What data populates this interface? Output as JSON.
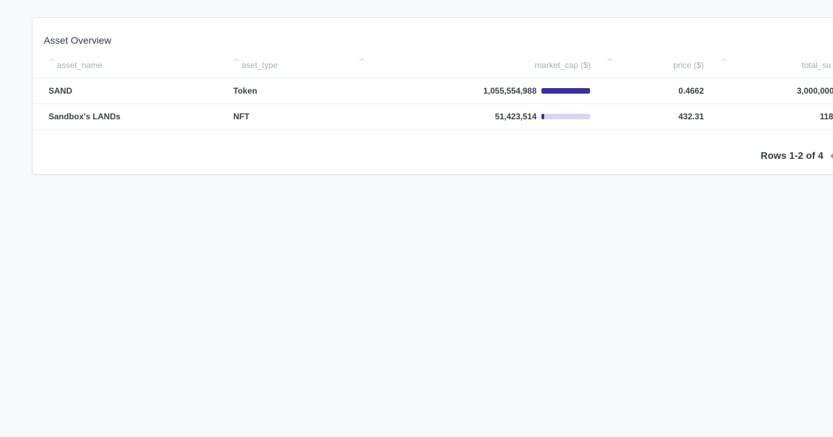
{
  "card": {
    "title": "Asset Overview"
  },
  "table": {
    "columns": [
      {
        "key": "asset_name",
        "label": "asset_name"
      },
      {
        "key": "aset_type",
        "label": "aset_type"
      },
      {
        "key": "market_cap",
        "label": "market_cap ($)"
      },
      {
        "key": "price",
        "label": "price ($)"
      },
      {
        "key": "total_supply",
        "label": "total_su"
      }
    ],
    "rows": [
      {
        "asset_name": "SAND",
        "aset_type": "Token",
        "market_cap": "1,055,554,988",
        "market_cap_fraction": 1.0,
        "price": "0.4662",
        "total_supply": "3,000,000"
      },
      {
        "asset_name": "Sandbox's LANDs",
        "aset_type": "NFT",
        "market_cap": "51,423,514",
        "market_cap_fraction": 0.0487,
        "price": "432.31",
        "total_supply": "118"
      }
    ]
  },
  "pagination": {
    "rows_info": "Rows 1-2 of 4"
  },
  "colors": {
    "bar_fill": "#3730a3",
    "bar_track": "#d6d8f0"
  }
}
